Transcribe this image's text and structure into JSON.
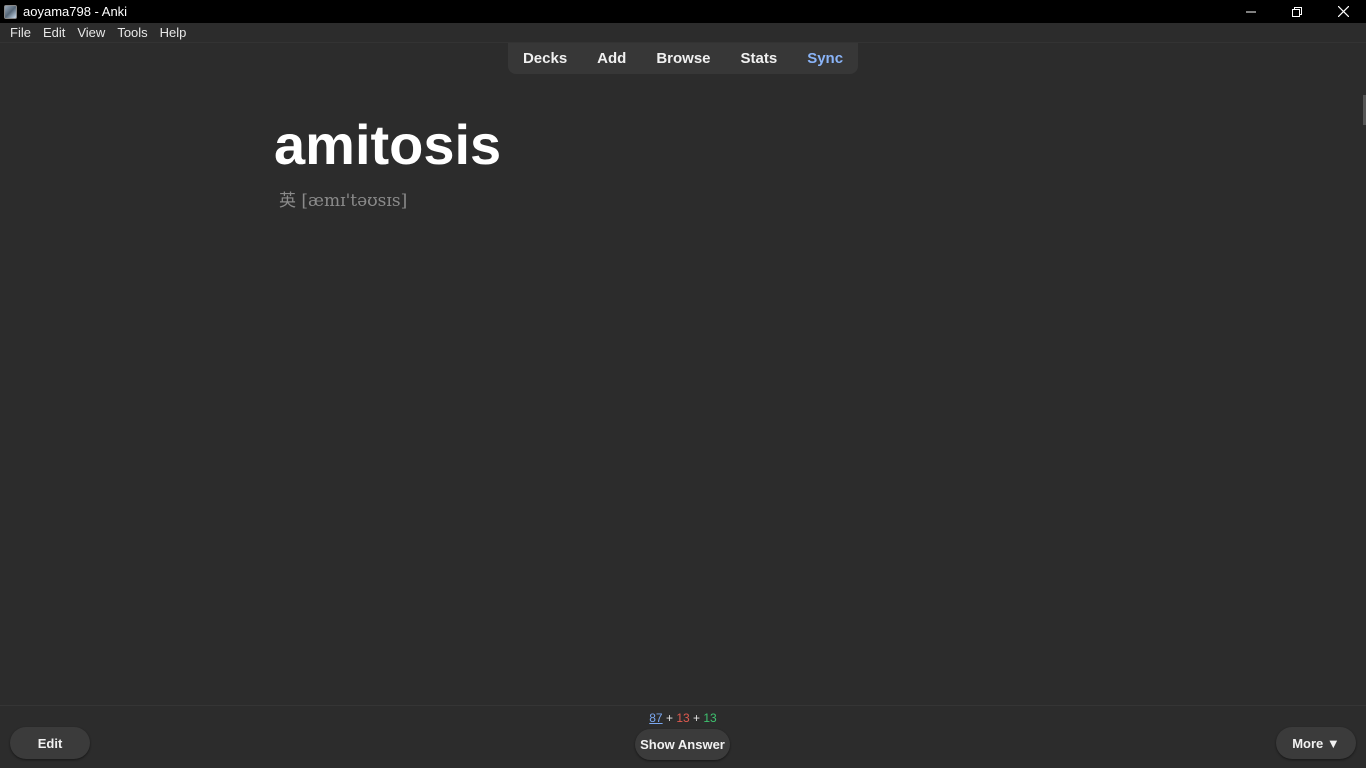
{
  "window": {
    "title": "aoyama798 - Anki"
  },
  "menu": [
    "File",
    "Edit",
    "View",
    "Tools",
    "Help"
  ],
  "toolbar": {
    "decks": "Decks",
    "add": "Add",
    "browse": "Browse",
    "stats": "Stats",
    "sync": "Sync"
  },
  "card": {
    "word": "amitosis",
    "phonetic": "英 [æmɪ'təʊsɪs]"
  },
  "counts": {
    "new": "87",
    "learning": "13",
    "review": "13",
    "sep": "+"
  },
  "bottom": {
    "edit": "Edit",
    "show_answer": "Show Answer",
    "more": "More ▼"
  }
}
